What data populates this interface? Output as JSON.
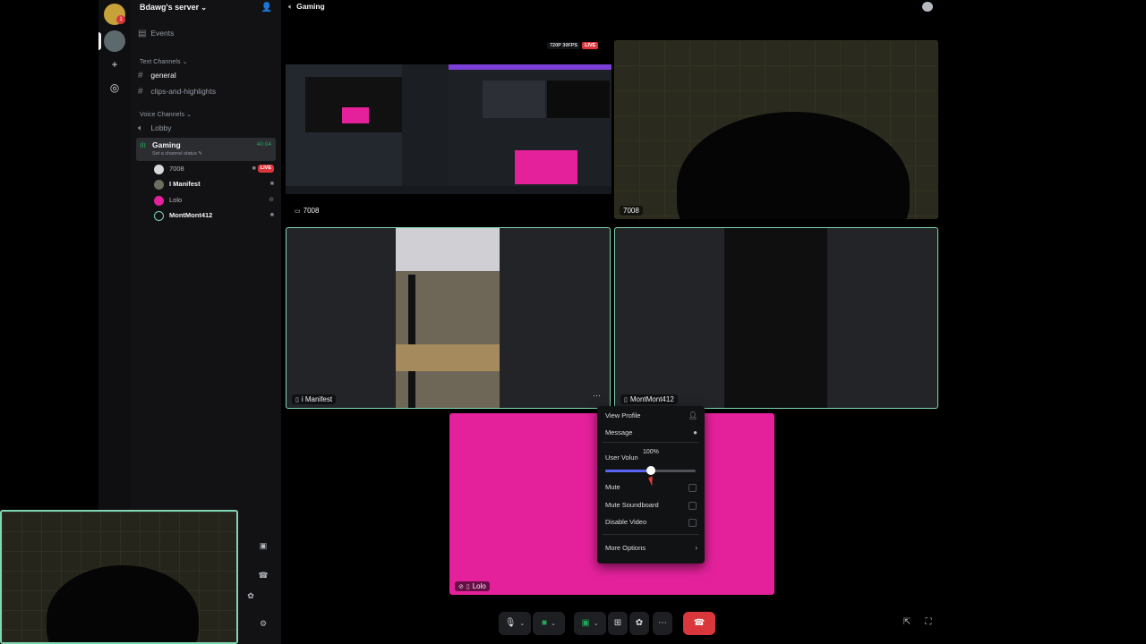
{
  "server": {
    "name": "Bdawg's server",
    "badge_count": "1"
  },
  "sidebar": {
    "events_label": "Events",
    "text_category": "Text Channels",
    "text_channels": [
      {
        "name": "general"
      },
      {
        "name": "clips-and-highlights"
      }
    ],
    "voice_category": "Voice Channels",
    "voice_channels": [
      {
        "name": "Lobby"
      },
      {
        "name": "Gaming",
        "timer": "40:04",
        "status": "Set a channel status"
      }
    ],
    "members": [
      {
        "name": "7008",
        "badge": "LIVE"
      },
      {
        "name": "I Manifest"
      },
      {
        "name": "Lolo"
      },
      {
        "name": "MontMont412"
      }
    ]
  },
  "channel_header": {
    "title": "Gaming"
  },
  "tiles": [
    {
      "label": "7008",
      "quality": "720P 30FPS",
      "badge": "LIVE"
    },
    {
      "label": "7008"
    },
    {
      "label": "i Manifest"
    },
    {
      "label": "MontMont412"
    },
    {
      "label": "Lolo"
    }
  ],
  "context_menu": {
    "view_profile": "View Profile",
    "message": "Message",
    "user_volume_label": "User Volun",
    "volume_value": "100%",
    "volume_fraction": 0.5,
    "mute": "Mute",
    "mute_soundboard": "Mute Soundboard",
    "disable_video": "Disable Video",
    "more_options": "More Options"
  },
  "colors": {
    "accent": "#5865f2",
    "speaking": "#7ed7b3",
    "live": "#da373c",
    "online": "#23a55a",
    "lolo_bg": "#e4219b"
  }
}
